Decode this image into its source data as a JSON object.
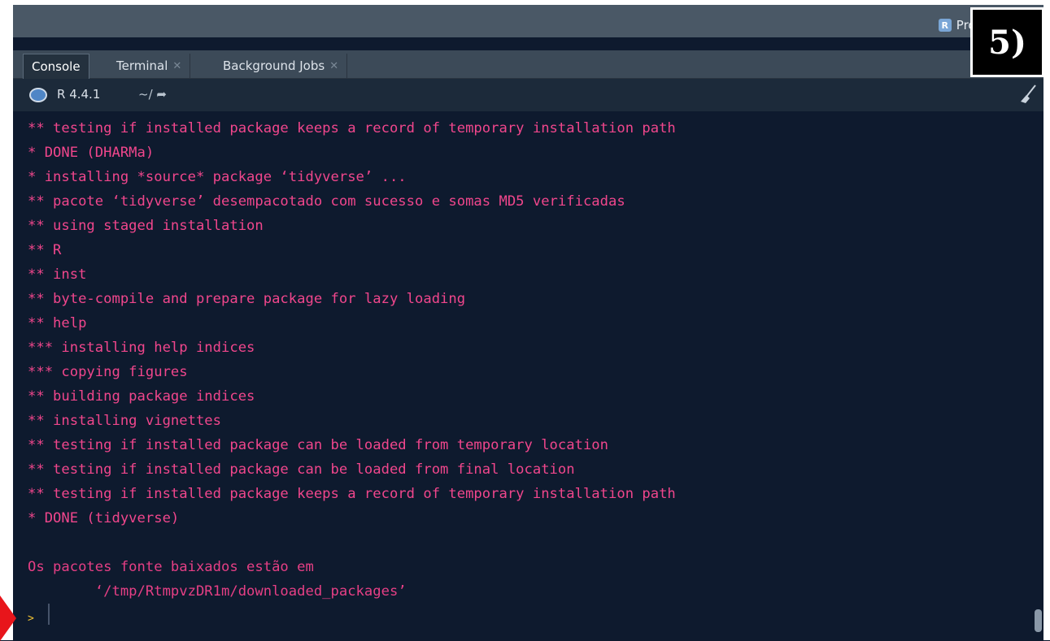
{
  "header": {
    "project_label": "Proje",
    "r_logo": "R"
  },
  "annotation": {
    "step_label": "5)"
  },
  "tabs": [
    {
      "label": "Console",
      "closable": false
    },
    {
      "label": "Terminal",
      "closable": true
    },
    {
      "label": "Background Jobs",
      "closable": true
    }
  ],
  "toolbar": {
    "r_version": "R 4.4.1",
    "working_dir": "~/"
  },
  "console": {
    "lines": [
      "** testing if installed package keeps a record of temporary installation path",
      "* DONE (DHARMa)",
      "* installing *source* package ‘tidyverse’ ...",
      "** pacote ‘tidyverse’ desempacotado com sucesso e somas MD5 verificadas",
      "** using staged installation",
      "** R",
      "** inst",
      "** byte-compile and prepare package for lazy loading",
      "** help",
      "*** installing help indices",
      "*** copying figures",
      "** building package indices",
      "** installing vignettes",
      "** testing if installed package can be loaded from temporary location",
      "** testing if installed package can be loaded from final location",
      "** testing if installed package keeps a record of temporary installation path",
      "* DONE (tidyverse)",
      "",
      "Os pacotes fonte baixados estão em",
      "        ‘/tmp/RtmpvzDR1m/downloaded_packages’"
    ],
    "prompt": ">"
  },
  "colors": {
    "console_text": "#f0468c",
    "prompt": "#f1c232",
    "arrow": "#e8151b"
  }
}
